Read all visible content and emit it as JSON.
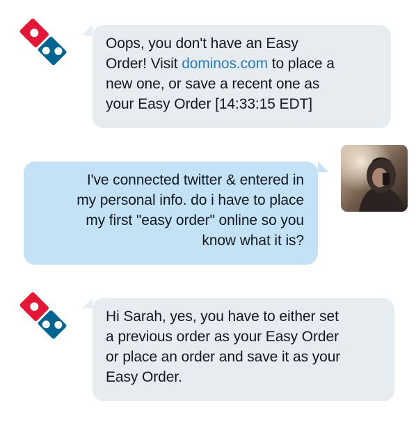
{
  "conversation": {
    "messages": [
      {
        "sender": "brand",
        "avatar_icon": "dominos-logo-icon",
        "text_before_link": "Oops, you don't have an Easy\nOrder! Visit ",
        "link_text": "dominos.com",
        "text_after_link": " to place a\nnew one, or save a recent one as\nyour Easy Order [14:33:15 EDT]"
      },
      {
        "sender": "user",
        "avatar_icon": "user-photo-avatar",
        "text": "I've connected twitter & entered in\nmy personal info. do i have to place\nmy first \"easy order\" online so you\nknow what it is?"
      },
      {
        "sender": "brand",
        "avatar_icon": "dominos-logo-icon",
        "text": "Hi Sarah, yes, you have to either set\na previous order as your Easy Order\nor place an order and save it as your\nEasy Order."
      }
    ]
  },
  "colors": {
    "brand_bubble": "#e6ecf0",
    "user_bubble": "#c4e2f6",
    "link": "#2b7bb9",
    "logo_red": "#e31837",
    "logo_blue": "#006491",
    "text": "#141823"
  }
}
